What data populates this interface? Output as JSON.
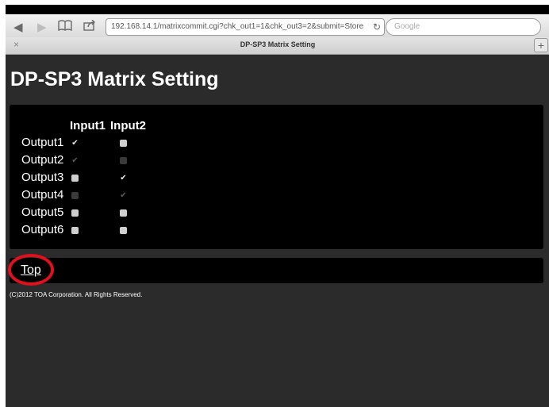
{
  "browser": {
    "url": "192.168.14.1/matrixcommit.cgi?chk_out1=1&chk_out3=2&submit=Store",
    "search_placeholder": "Google",
    "tab_title": "DP-SP3 Matrix Setting",
    "tab_close": "×",
    "tab_add": "+",
    "icons": [
      "back-arrow-icon",
      "forward-arrow-icon",
      "bookmarks-icon",
      "share-icon",
      "reload-icon"
    ]
  },
  "page": {
    "title": "DP-SP3 Matrix Setting",
    "matrix": {
      "columns": [
        "Input1",
        "Input2"
      ],
      "rows": [
        {
          "label": "Output1",
          "input1": {
            "checked": true,
            "enabled": true
          },
          "input2": {
            "checked": false,
            "enabled": true
          }
        },
        {
          "label": "Output2",
          "input1": {
            "checked": true,
            "enabled": false
          },
          "input2": {
            "checked": false,
            "enabled": false
          }
        },
        {
          "label": "Output3",
          "input1": {
            "checked": false,
            "enabled": true
          },
          "input2": {
            "checked": true,
            "enabled": true
          }
        },
        {
          "label": "Output4",
          "input1": {
            "checked": false,
            "enabled": false
          },
          "input2": {
            "checked": true,
            "enabled": false
          }
        },
        {
          "label": "Output5",
          "input1": {
            "checked": false,
            "enabled": true
          },
          "input2": {
            "checked": false,
            "enabled": true
          }
        },
        {
          "label": "Output6",
          "input1": {
            "checked": false,
            "enabled": true
          },
          "input2": {
            "checked": false,
            "enabled": true
          }
        }
      ]
    },
    "top_link": "Top",
    "copyright": "(C)2012 TOA Corporation. All Rights Reserved."
  },
  "colors": {
    "page_bg": "#2b2b2b",
    "panel_bg": "#000000",
    "text": "#ffffff",
    "annotation_ring": "#e0101d"
  }
}
